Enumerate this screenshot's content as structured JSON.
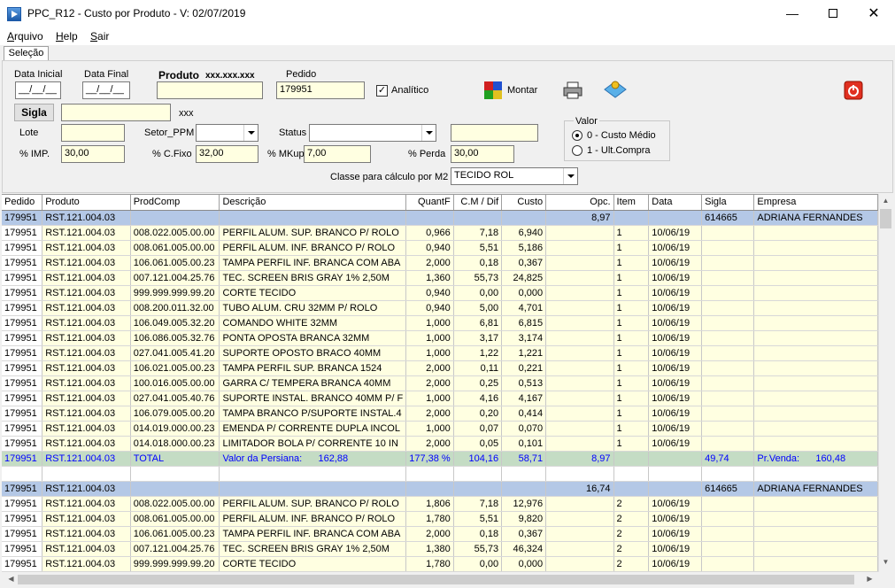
{
  "window": {
    "title": "PPC_R12 - Custo por Produto - V: 02/07/2019"
  },
  "menu": [
    "Arquivo",
    "Help",
    "Sair"
  ],
  "tab": "Seleção",
  "form": {
    "data_inicial_label": "Data Inicial",
    "data_inicial_value": "__/__/__",
    "data_final_label": "Data Final",
    "data_final_value": "__/__/__",
    "produto_label": "Produto",
    "produto_mask": "xxx.xxx.xxx",
    "produto_value": "",
    "pedido_label": "Pedido",
    "pedido_value": "179951",
    "analitico_label": "Analítico",
    "analitico_checked": true,
    "montar_label": "Montar",
    "sigla_label": "Sigla",
    "sigla_value": "",
    "sigla_suffix": "xxx",
    "lote_label": "Lote",
    "lote_value": "",
    "setor_label": "Setor_PPM",
    "setor_value": "",
    "status_label": "Status",
    "status_value": "",
    "status_extra_value": "",
    "imp_label": "% IMP.",
    "imp_value": "30,00",
    "cfixo_label": "% C.Fixo",
    "cfixo_value": "32,00",
    "mkup_label": "% MKup.",
    "mkup_value": "7,00",
    "perda_label": "% Perda",
    "perda_value": "30,00",
    "classe_label": "Classe para cálculo por M2",
    "classe_value": "TECIDO ROL",
    "valor_group_label": "Valor",
    "valor_options": [
      "0 - Custo Médio",
      "1 - Ult.Compra"
    ],
    "valor_selected": 0
  },
  "grid": {
    "columns": [
      "Pedido",
      "Produto",
      "ProdComp",
      "Descrição",
      "QuantF",
      "C.M / Dif",
      "Custo",
      "Opc.",
      "Item",
      "Data",
      "Sigla",
      "Empresa"
    ],
    "rows": [
      {
        "type": "header",
        "cells": [
          "179951",
          "RST.121.004.03",
          "",
          "",
          "",
          "",
          "",
          "8,97",
          "",
          "",
          "614665",
          "ADRIANA FERNANDES"
        ]
      },
      {
        "type": "item",
        "cells": [
          "179951",
          "RST.121.004.03",
          "008.022.005.00.00",
          "PERFIL ALUM. SUP. BRANCO P/ ROLO",
          "0,966",
          "7,18",
          "6,940",
          "",
          "1",
          "10/06/19",
          "",
          ""
        ]
      },
      {
        "type": "item",
        "cells": [
          "179951",
          "RST.121.004.03",
          "008.061.005.00.00",
          "PERFIL ALUM. INF. BRANCO P/ ROLO",
          "0,940",
          "5,51",
          "5,186",
          "",
          "1",
          "10/06/19",
          "",
          ""
        ]
      },
      {
        "type": "item",
        "cells": [
          "179951",
          "RST.121.004.03",
          "106.061.005.00.23",
          "TAMPA PERFIL INF. BRANCA COM ABA",
          "2,000",
          "0,18",
          "0,367",
          "",
          "1",
          "10/06/19",
          "",
          ""
        ]
      },
      {
        "type": "item",
        "cells": [
          "179951",
          "RST.121.004.03",
          "007.121.004.25.76",
          "TEC. SCREEN BRIS GRAY 1% 2,50M",
          "1,360",
          "55,73",
          "24,825",
          "",
          "1",
          "10/06/19",
          "",
          ""
        ]
      },
      {
        "type": "item",
        "cells": [
          "179951",
          "RST.121.004.03",
          "999.999.999.99.20",
          "CORTE TECIDO",
          "0,940",
          "0,00",
          "0,000",
          "",
          "1",
          "10/06/19",
          "",
          ""
        ]
      },
      {
        "type": "item",
        "cells": [
          "179951",
          "RST.121.004.03",
          "008.200.011.32.00",
          "TUBO ALUM. CRU 32MM P/ ROLO",
          "0,940",
          "5,00",
          "4,701",
          "",
          "1",
          "10/06/19",
          "",
          ""
        ]
      },
      {
        "type": "item",
        "cells": [
          "179951",
          "RST.121.004.03",
          "106.049.005.32.20",
          "COMANDO WHITE 32MM",
          "1,000",
          "6,81",
          "6,815",
          "",
          "1",
          "10/06/19",
          "",
          ""
        ]
      },
      {
        "type": "item",
        "cells": [
          "179951",
          "RST.121.004.03",
          "106.086.005.32.76",
          "PONTA OPOSTA BRANCA 32MM",
          "1,000",
          "3,17",
          "3,174",
          "",
          "1",
          "10/06/19",
          "",
          ""
        ]
      },
      {
        "type": "item",
        "cells": [
          "179951",
          "RST.121.004.03",
          "027.041.005.41.20",
          "SUPORTE OPOSTO BRACO 40MM",
          "1,000",
          "1,22",
          "1,221",
          "",
          "1",
          "10/06/19",
          "",
          ""
        ]
      },
      {
        "type": "item",
        "cells": [
          "179951",
          "RST.121.004.03",
          "106.021.005.00.23",
          "TAMPA PERFIL SUP. BRANCA 1524",
          "2,000",
          "0,11",
          "0,221",
          "",
          "1",
          "10/06/19",
          "",
          ""
        ]
      },
      {
        "type": "item",
        "cells": [
          "179951",
          "RST.121.004.03",
          "100.016.005.00.00",
          "GARRA C/ TEMPERA BRANCA 40MM",
          "2,000",
          "0,25",
          "0,513",
          "",
          "1",
          "10/06/19",
          "",
          ""
        ]
      },
      {
        "type": "item",
        "cells": [
          "179951",
          "RST.121.004.03",
          "027.041.005.40.76",
          "SUPORTE INSTAL. BRANCO 40MM P/ F",
          "1,000",
          "4,16",
          "4,167",
          "",
          "1",
          "10/06/19",
          "",
          ""
        ]
      },
      {
        "type": "item",
        "cells": [
          "179951",
          "RST.121.004.03",
          "106.079.005.00.20",
          "TAMPA BRANCO P/SUPORTE INSTAL.4",
          "2,000",
          "0,20",
          "0,414",
          "",
          "1",
          "10/06/19",
          "",
          ""
        ]
      },
      {
        "type": "item",
        "cells": [
          "179951",
          "RST.121.004.03",
          "014.019.000.00.23",
          "EMENDA P/ CORRENTE DUPLA INCOL",
          "1,000",
          "0,07",
          "0,070",
          "",
          "1",
          "10/06/19",
          "",
          ""
        ]
      },
      {
        "type": "item",
        "cells": [
          "179951",
          "RST.121.004.03",
          "014.018.000.00.23",
          "LIMITADOR BOLA P/ CORRENTE 10 IN",
          "2,000",
          "0,05",
          "0,101",
          "",
          "1",
          "10/06/19",
          "",
          ""
        ]
      },
      {
        "type": "total",
        "cells": [
          "179951",
          "RST.121.004.03",
          "TOTAL",
          "Valor da Persiana:      162,88",
          "177,38 %",
          "104,16",
          "58,71",
          "8,97",
          "",
          "",
          "49,74",
          "Pr.Venda:      160,48"
        ]
      },
      {
        "type": "blank",
        "cells": [
          "",
          "",
          "",
          "",
          "",
          "",
          "",
          "",
          "",
          "",
          "",
          ""
        ]
      },
      {
        "type": "header",
        "cells": [
          "179951",
          "RST.121.004.03",
          "",
          "",
          "",
          "",
          "",
          "16,74",
          "",
          "",
          "614665",
          "ADRIANA FERNANDES"
        ]
      },
      {
        "type": "item",
        "cells": [
          "179951",
          "RST.121.004.03",
          "008.022.005.00.00",
          "PERFIL ALUM. SUP. BRANCO P/ ROLO",
          "1,806",
          "7,18",
          "12,976",
          "",
          "2",
          "10/06/19",
          "",
          ""
        ]
      },
      {
        "type": "item",
        "cells": [
          "179951",
          "RST.121.004.03",
          "008.061.005.00.00",
          "PERFIL ALUM. INF. BRANCO P/ ROLO",
          "1,780",
          "5,51",
          "9,820",
          "",
          "2",
          "10/06/19",
          "",
          ""
        ]
      },
      {
        "type": "item",
        "cells": [
          "179951",
          "RST.121.004.03",
          "106.061.005.00.23",
          "TAMPA PERFIL INF. BRANCA COM ABA",
          "2,000",
          "0,18",
          "0,367",
          "",
          "2",
          "10/06/19",
          "",
          ""
        ]
      },
      {
        "type": "item",
        "cells": [
          "179951",
          "RST.121.004.03",
          "007.121.004.25.76",
          "TEC. SCREEN BRIS GRAY 1% 2,50M",
          "1,380",
          "55,73",
          "46,324",
          "",
          "2",
          "10/06/19",
          "",
          ""
        ]
      },
      {
        "type": "item",
        "cells": [
          "179951",
          "RST.121.004.03",
          "999.999.999.99.20",
          "CORTE TECIDO",
          "1,780",
          "0,00",
          "0,000",
          "",
          "2",
          "10/06/19",
          "",
          ""
        ]
      }
    ]
  },
  "colors": {
    "input_bg": "#ffffe1",
    "header_row_bg": "#b4c8e6",
    "total_row_bg": "#c4dcc4",
    "total_text": "#0000ff"
  }
}
